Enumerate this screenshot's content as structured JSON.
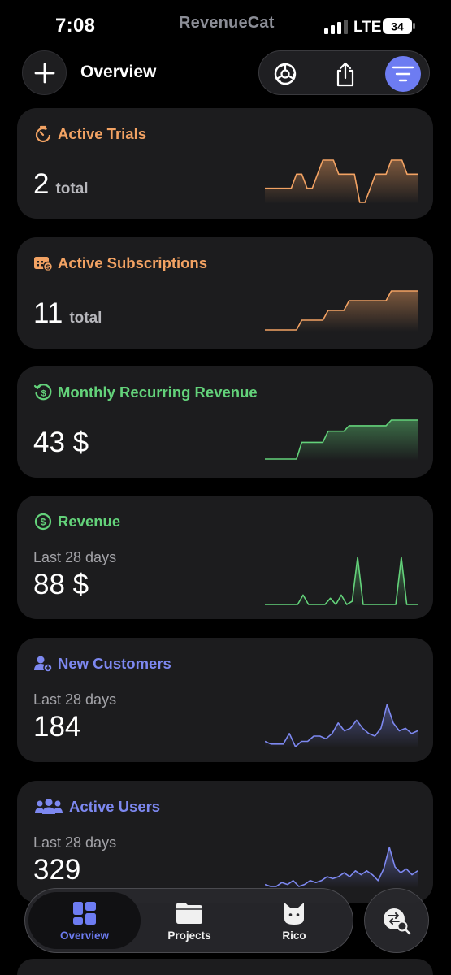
{
  "status_bar": {
    "time": "7:08",
    "brand": "RevenueCat",
    "network": "LTE",
    "battery": "34"
  },
  "header": {
    "title": "Overview",
    "add_icon": "plus-icon",
    "tools": [
      "settings-icon",
      "share-icon",
      "filter-icon"
    ],
    "accent": "#6d7cf2"
  },
  "cards": [
    {
      "title": "Active Trials",
      "icon": "timer-icon",
      "color": "#f2a263",
      "value": "2",
      "unit": "total",
      "sparkline": [
        1,
        1,
        1,
        1,
        1,
        1,
        2,
        2,
        1,
        1,
        2,
        3,
        3,
        3,
        2,
        2,
        2,
        2,
        0,
        0,
        1,
        2,
        2,
        2,
        3,
        3,
        3,
        2,
        2,
        2
      ]
    },
    {
      "title": "Active Subscriptions",
      "icon": "calendar-dollar-icon",
      "color": "#f2a263",
      "value": "11",
      "unit": "total",
      "sparkline": [
        8,
        8,
        8,
        8,
        8,
        8,
        8,
        9,
        9,
        9,
        9,
        9,
        10,
        10,
        10,
        10,
        11,
        11,
        11,
        11,
        11,
        11,
        11,
        11,
        12,
        12,
        12,
        12,
        12,
        12
      ]
    },
    {
      "title": "Monthly Recurring Revenue",
      "icon": "recurring-dollar-icon",
      "color": "#63d27a",
      "value": "43 $",
      "unit": "",
      "sparkline": [
        34,
        34,
        34,
        34,
        34,
        34,
        34,
        37,
        37,
        37,
        37,
        37,
        39,
        39,
        39,
        39,
        40,
        40,
        40,
        40,
        40,
        40,
        40,
        40,
        41,
        41,
        41,
        41,
        41,
        41
      ]
    },
    {
      "title": "Revenue",
      "icon": "dollar-circle-icon",
      "color": "#63d27a",
      "sub_label": "Last 28 days",
      "value": "88 $",
      "unit": "",
      "sparkline": [
        0,
        0,
        0,
        0,
        0,
        0,
        0,
        3,
        0,
        0,
        0,
        0,
        2,
        0,
        3,
        0,
        1,
        15,
        0,
        0,
        0,
        0,
        0,
        0,
        0,
        15,
        0,
        0,
        0
      ]
    },
    {
      "title": "New Customers",
      "icon": "person-add-icon",
      "color": "#7d88f0",
      "sub_label": "Last 28 days",
      "value": "184",
      "unit": "",
      "sparkline": [
        4,
        3,
        3,
        3,
        7,
        2,
        4,
        4,
        6,
        6,
        5,
        7,
        11,
        8,
        9,
        12,
        9,
        7,
        6,
        9,
        18,
        11,
        8,
        9,
        7,
        8
      ]
    },
    {
      "title": "Active Users",
      "icon": "people-icon",
      "color": "#7d88f0",
      "sub_label": "Last 28 days",
      "value": "329",
      "unit": "",
      "sparkline": [
        5,
        4,
        4,
        6,
        5,
        7,
        4,
        5,
        7,
        6,
        7,
        9,
        8,
        9,
        11,
        9,
        12,
        10,
        12,
        10,
        7,
        13,
        24,
        14,
        11,
        13,
        10,
        12
      ]
    }
  ],
  "tabbar": {
    "tabs": [
      {
        "label": "Overview",
        "icon": "dashboard-icon",
        "active": true
      },
      {
        "label": "Projects",
        "icon": "folder-icon",
        "active": false
      },
      {
        "label": "Rico",
        "icon": "cat-icon",
        "active": false
      }
    ],
    "fab_icon": "switch-search-icon"
  }
}
